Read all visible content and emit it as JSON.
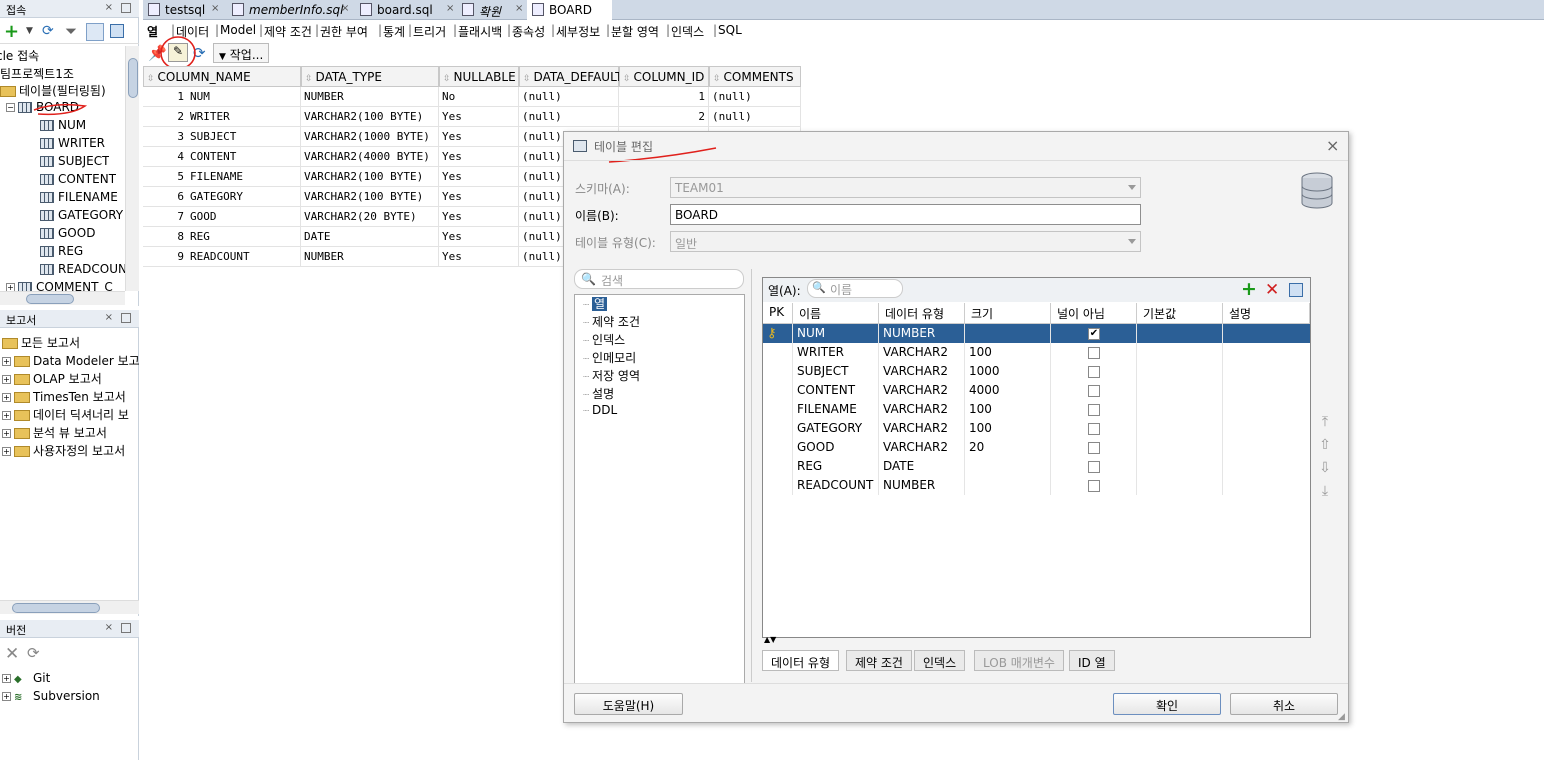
{
  "panels": {
    "connections": {
      "title": "접속",
      "tree": [
        {
          "label": "cle 접속",
          "level": 0
        },
        {
          "label": "팀프로젝트1조",
          "level": 0
        },
        {
          "label": "테이블(필터링됨)",
          "level": 0
        },
        {
          "label": "BOARD",
          "level": 1
        },
        {
          "label": "NUM",
          "level": 2
        },
        {
          "label": "WRITER",
          "level": 2
        },
        {
          "label": "SUBJECT",
          "level": 2
        },
        {
          "label": "CONTENT",
          "level": 2
        },
        {
          "label": "FILENAME",
          "level": 2
        },
        {
          "label": "GATEGORY",
          "level": 2
        },
        {
          "label": "GOOD",
          "level": 2
        },
        {
          "label": "REG",
          "level": 2
        },
        {
          "label": "READCOUN",
          "level": 2
        },
        {
          "label": "COMMENT_C",
          "level": 1
        }
      ]
    },
    "reports": {
      "title": "보고서",
      "tree": [
        {
          "label": "모든 보고서"
        },
        {
          "label": "Data Modeler 보고"
        },
        {
          "label": "OLAP 보고서"
        },
        {
          "label": "TimesTen 보고서"
        },
        {
          "label": "데이터 딕셔너리 보"
        },
        {
          "label": "분석 뷰 보고서"
        },
        {
          "label": "사용자정의 보고서"
        }
      ]
    },
    "versions": {
      "title": "버전",
      "tree": [
        {
          "label": "Git"
        },
        {
          "label": "Subversion"
        }
      ]
    }
  },
  "editor_tabs": [
    "testsql",
    "memberInfo.sql",
    "board.sql",
    "확원",
    "BOARD"
  ],
  "sub_tabs": [
    "열",
    "데이터",
    "Model",
    "제약 조건",
    "권한 부여",
    "통계",
    "트리거",
    "플래시백",
    "종속성",
    "세부정보",
    "분할 영역",
    "인덱스",
    "SQL"
  ],
  "toolbar": {
    "actions_label": "작업..."
  },
  "grid": {
    "headers": [
      "COLUMN_NAME",
      "DATA_TYPE",
      "NULLABLE",
      "DATA_DEFAULT",
      "COLUMN_ID",
      "COMMENTS"
    ],
    "rows": [
      {
        "n": "1",
        "name": "NUM",
        "type": "NUMBER",
        "nullable": "No",
        "def": "(null)",
        "id": "1",
        "comments": "(null)"
      },
      {
        "n": "2",
        "name": "WRITER",
        "type": "VARCHAR2(100 BYTE)",
        "nullable": "Yes",
        "def": "(null)",
        "id": "2",
        "comments": "(null)"
      },
      {
        "n": "3",
        "name": "SUBJECT",
        "type": "VARCHAR2(1000 BYTE)",
        "nullable": "Yes",
        "def": "(null)",
        "id": "",
        "comments": ""
      },
      {
        "n": "4",
        "name": "CONTENT",
        "type": "VARCHAR2(4000 BYTE)",
        "nullable": "Yes",
        "def": "(null)",
        "id": "",
        "comments": ""
      },
      {
        "n": "5",
        "name": "FILENAME",
        "type": "VARCHAR2(100 BYTE)",
        "nullable": "Yes",
        "def": "(null)",
        "id": "",
        "comments": ""
      },
      {
        "n": "6",
        "name": "GATEGORY",
        "type": "VARCHAR2(100 BYTE)",
        "nullable": "Yes",
        "def": "(null)",
        "id": "",
        "comments": ""
      },
      {
        "n": "7",
        "name": "GOOD",
        "type": "VARCHAR2(20 BYTE)",
        "nullable": "Yes",
        "def": "(null)",
        "id": "",
        "comments": ""
      },
      {
        "n": "8",
        "name": "REG",
        "type": "DATE",
        "nullable": "Yes",
        "def": "(null)",
        "id": "",
        "comments": ""
      },
      {
        "n": "9",
        "name": "READCOUNT",
        "type": "NUMBER",
        "nullable": "Yes",
        "def": "(null)",
        "id": "",
        "comments": ""
      }
    ]
  },
  "dialog": {
    "title": "테이블 편집",
    "schema_label": "스키마(A):",
    "schema_value": "TEAM01",
    "name_label": "이름(B):",
    "name_value": "BOARD",
    "type_label": "테이블 유형(C):",
    "type_value": "일반",
    "search_placeholder": "검색",
    "nav_items": [
      "열",
      "제약 조건",
      "인덱스",
      "인메모리",
      "저장 영역",
      "설명",
      "DDL"
    ],
    "columns_label": "열(A):",
    "filter_placeholder": "이름",
    "col_headers": [
      "PK",
      "이름",
      "데이터 유형",
      "크기",
      "널이 아님",
      "기본값",
      "설명"
    ],
    "col_rows": [
      {
        "name": "NUM",
        "type": "NUMBER",
        "size": "",
        "notnull": true,
        "pk": true
      },
      {
        "name": "WRITER",
        "type": "VARCHAR2",
        "size": "100",
        "notnull": false,
        "pk": false
      },
      {
        "name": "SUBJECT",
        "type": "VARCHAR2",
        "size": "1000",
        "notnull": false,
        "pk": false
      },
      {
        "name": "CONTENT",
        "type": "VARCHAR2",
        "size": "4000",
        "notnull": false,
        "pk": false
      },
      {
        "name": "FILENAME",
        "type": "VARCHAR2",
        "size": "100",
        "notnull": false,
        "pk": false
      },
      {
        "name": "GATEGORY",
        "type": "VARCHAR2",
        "size": "100",
        "notnull": false,
        "pk": false
      },
      {
        "name": "GOOD",
        "type": "VARCHAR2",
        "size": "20",
        "notnull": false,
        "pk": false
      },
      {
        "name": "REG",
        "type": "DATE",
        "size": "",
        "notnull": false,
        "pk": false
      },
      {
        "name": "READCOUNT",
        "type": "NUMBER",
        "size": "",
        "notnull": false,
        "pk": false
      }
    ],
    "detail_tabs": [
      "데이터 유형",
      "제약 조건",
      "인덱스",
      "LOB 매개변수",
      "ID 열"
    ],
    "help_button": "도움말(H)",
    "ok_button": "확인",
    "cancel_button": "취소"
  },
  "colors": {
    "selection": "#2b5f96",
    "accent": "#cfd9e6",
    "annotation": "#e0201b"
  }
}
